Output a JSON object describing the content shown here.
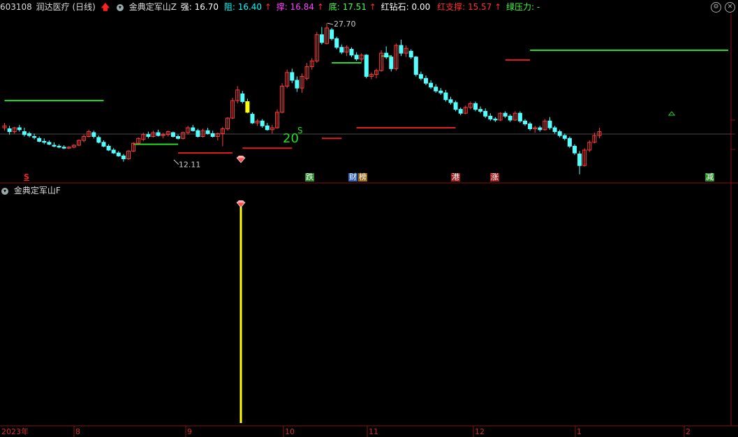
{
  "header": {
    "code": "603108",
    "name": "润达医疗",
    "period": "(日线)",
    "indicator": "金典定军山Z",
    "strong_label": "强:",
    "strong_value": "16.70",
    "resist_label": "阻:",
    "resist_value": "16.40",
    "support_label": "撑:",
    "support_value": "16.84",
    "bottom_label": "底:",
    "bottom_value": "17.51",
    "diamond_label": "红钻石:",
    "diamond_value": "0.00",
    "red_support_label": "红支撑:",
    "red_support_value": "15.57",
    "green_pressure_label": "绿压力:",
    "green_pressure_value": "-",
    "colors": {
      "strong": "#ffffff",
      "resist": "#00ffff",
      "support": "#ff40ff",
      "bottom": "#40ff40",
      "diamond": "#ffffff",
      "red_support": "#ff3030",
      "green_pressure": "#40ff40"
    }
  },
  "sub_panel": {
    "title": "金典定军山F"
  },
  "annotations": {
    "high": "27.70",
    "low": "12.11",
    "green_num": "20",
    "green_s": "S"
  },
  "event_tags": [
    {
      "text": "S",
      "color": "#ff2020",
      "bg": "none"
    },
    {
      "text": "跌",
      "color": "#ffffff",
      "bg": "#2a8a2a"
    },
    {
      "text": "财",
      "color": "#ffffff",
      "bg": "#2b5fb0"
    },
    {
      "text": "榜",
      "color": "#ffffff",
      "bg": "#9a6a20"
    },
    {
      "text": "港",
      "color": "#ffffff",
      "bg": "#a02020"
    },
    {
      "text": "涨",
      "color": "#ffffff",
      "bg": "#a02020"
    },
    {
      "text": "减",
      "color": "#ffffff",
      "bg": "#2a8a2a"
    }
  ],
  "time_axis": [
    "2023年",
    "8",
    "9",
    "10",
    "11",
    "12",
    "1",
    "2"
  ],
  "colors": {
    "up": "#ff3c3c",
    "down": "#54ffff",
    "green_line": "#22dd22",
    "red_line": "#e02020",
    "grid": "#8a1010",
    "signal_bar": "#ffff00"
  },
  "chart_data": {
    "type": "candlestick",
    "ylim": [
      11.5,
      28.5
    ],
    "candles": [
      [
        16.9,
        17.4,
        16.6,
        17.1
      ],
      [
        16.8,
        17.1,
        16.2,
        16.5
      ],
      [
        16.5,
        17.0,
        16.3,
        16.9
      ],
      [
        16.9,
        17.2,
        16.5,
        16.7
      ],
      [
        16.5,
        16.9,
        16.0,
        16.2
      ],
      [
        16.3,
        16.5,
        15.9,
        16.1
      ],
      [
        16.0,
        16.3,
        15.7,
        15.9
      ],
      [
        15.8,
        16.0,
        15.4,
        15.5
      ],
      [
        15.5,
        15.8,
        15.2,
        15.4
      ],
      [
        15.4,
        15.6,
        15.1,
        15.2
      ],
      [
        15.1,
        15.4,
        14.9,
        15.0
      ],
      [
        15.0,
        15.2,
        14.8,
        14.9
      ],
      [
        14.9,
        15.1,
        14.7,
        14.8
      ],
      [
        14.8,
        15.0,
        14.7,
        14.9
      ],
      [
        14.9,
        15.2,
        14.8,
        15.1
      ],
      [
        15.1,
        15.7,
        15.0,
        15.6
      ],
      [
        15.6,
        16.2,
        15.4,
        16.0
      ],
      [
        16.0,
        16.7,
        15.9,
        16.5
      ],
      [
        16.4,
        16.6,
        15.8,
        16.0
      ],
      [
        15.9,
        16.1,
        15.3,
        15.4
      ],
      [
        15.4,
        15.6,
        14.9,
        15.0
      ],
      [
        15.0,
        15.2,
        14.5,
        14.6
      ],
      [
        14.6,
        14.8,
        14.2,
        14.3
      ],
      [
        14.3,
        14.5,
        13.9,
        14.0
      ],
      [
        14.0,
        14.2,
        13.4,
        13.7
      ],
      [
        13.7,
        14.6,
        13.6,
        14.5
      ],
      [
        14.5,
        15.4,
        14.4,
        15.3
      ],
      [
        15.3,
        15.9,
        15.1,
        15.8
      ],
      [
        15.7,
        16.4,
        15.5,
        16.2
      ],
      [
        16.2,
        16.5,
        15.8,
        16.0
      ],
      [
        16.0,
        16.6,
        15.9,
        16.4
      ],
      [
        16.4,
        16.7,
        16.0,
        16.1
      ],
      [
        16.1,
        16.4,
        15.8,
        16.2
      ],
      [
        16.2,
        16.6,
        16.0,
        16.5
      ],
      [
        16.4,
        16.5,
        15.9,
        16.0
      ],
      [
        16.0,
        16.2,
        15.7,
        15.8
      ],
      [
        15.8,
        16.5,
        15.7,
        16.4
      ],
      [
        16.4,
        17.1,
        16.2,
        16.9
      ],
      [
        16.9,
        17.2,
        16.5,
        16.6
      ],
      [
        16.6,
        16.8,
        15.9,
        16.0
      ],
      [
        16.0,
        16.8,
        15.9,
        16.6
      ],
      [
        16.6,
        16.9,
        16.2,
        16.3
      ],
      [
        16.3,
        16.6,
        15.9,
        16.0
      ],
      [
        16.0,
        16.4,
        15.6,
        16.3
      ],
      [
        16.3,
        17.0,
        15.0,
        16.8
      ],
      [
        16.8,
        18.0,
        16.6,
        17.9
      ],
      [
        17.9,
        20.0,
        17.8,
        19.7
      ],
      [
        19.7,
        21.2,
        19.4,
        20.8
      ],
      [
        20.4,
        20.7,
        19.4,
        19.6
      ],
      [
        19.6,
        19.9,
        18.4,
        18.5
      ],
      [
        18.3,
        18.5,
        17.3,
        17.4
      ],
      [
        17.4,
        17.8,
        17.1,
        17.6
      ],
      [
        17.6,
        17.8,
        16.9,
        17.1
      ],
      [
        17.1,
        17.4,
        16.6,
        16.7
      ],
      [
        16.7,
        17.2,
        16.3,
        16.9
      ],
      [
        16.9,
        18.8,
        16.8,
        18.5
      ],
      [
        18.5,
        21.5,
        18.4,
        21.2
      ],
      [
        21.2,
        22.9,
        21.0,
        22.6
      ],
      [
        22.6,
        23.0,
        21.5,
        21.8
      ],
      [
        21.8,
        22.2,
        20.6,
        21.0
      ],
      [
        21.0,
        22.5,
        20.5,
        22.2
      ],
      [
        22.0,
        23.6,
        21.8,
        23.2
      ],
      [
        23.2,
        24.1,
        22.9,
        23.8
      ],
      [
        23.8,
        26.8,
        23.6,
        26.5
      ],
      [
        26.5,
        27.3,
        25.5,
        25.7
      ],
      [
        25.6,
        27.7,
        25.5,
        27.2
      ],
      [
        27.0,
        27.2,
        25.9,
        26.1
      ],
      [
        26.1,
        26.3,
        25.0,
        25.2
      ],
      [
        25.2,
        25.5,
        24.5,
        24.7
      ],
      [
        24.7,
        25.4,
        24.3,
        25.2
      ],
      [
        25.0,
        25.2,
        24.2,
        24.4
      ],
      [
        24.4,
        24.7,
        23.8,
        24.0
      ],
      [
        24.0,
        24.6,
        23.7,
        24.4
      ],
      [
        24.4,
        24.5,
        22.0,
        22.2
      ],
      [
        22.2,
        22.6,
        21.9,
        22.4
      ],
      [
        22.4,
        23.0,
        22.0,
        22.8
      ],
      [
        22.8,
        24.9,
        22.7,
        24.6
      ],
      [
        24.6,
        25.3,
        24.0,
        24.2
      ],
      [
        24.2,
        24.4,
        22.7,
        23.0
      ],
      [
        23.0,
        25.6,
        22.8,
        25.4
      ],
      [
        25.4,
        26.0,
        24.3,
        24.6
      ],
      [
        24.6,
        25.4,
        24.2,
        25.1
      ],
      [
        24.8,
        25.0,
        24.0,
        24.2
      ],
      [
        24.2,
        24.3,
        22.2,
        22.4
      ],
      [
        22.4,
        22.7,
        21.8,
        22.0
      ],
      [
        22.0,
        22.3,
        21.3,
        21.5
      ],
      [
        21.5,
        21.8,
        20.9,
        21.1
      ],
      [
        21.1,
        21.4,
        20.5,
        20.7
      ],
      [
        20.7,
        21.0,
        20.3,
        20.5
      ],
      [
        20.5,
        20.8,
        19.6,
        19.8
      ],
      [
        19.8,
        20.1,
        19.3,
        19.5
      ],
      [
        19.5,
        19.7,
        18.6,
        18.8
      ],
      [
        18.8,
        19.0,
        18.2,
        18.4
      ],
      [
        18.4,
        19.2,
        18.3,
        19.0
      ],
      [
        19.0,
        19.6,
        18.8,
        19.4
      ],
      [
        19.4,
        19.6,
        18.6,
        18.8
      ],
      [
        18.8,
        19.1,
        18.4,
        18.6
      ],
      [
        18.6,
        18.9,
        17.9,
        18.1
      ],
      [
        18.1,
        18.4,
        17.6,
        17.8
      ],
      [
        17.8,
        18.0,
        17.5,
        17.7
      ],
      [
        17.7,
        18.5,
        17.6,
        18.4
      ],
      [
        18.4,
        18.6,
        17.9,
        18.1
      ],
      [
        18.1,
        18.3,
        17.5,
        17.7
      ],
      [
        17.7,
        18.6,
        17.6,
        18.4
      ],
      [
        18.4,
        18.6,
        17.4,
        17.6
      ],
      [
        17.6,
        17.8,
        17.1,
        17.3
      ],
      [
        17.3,
        17.5,
        16.6,
        16.8
      ],
      [
        16.8,
        17.1,
        16.4,
        16.9
      ],
      [
        16.9,
        17.1,
        16.5,
        16.7
      ],
      [
        16.7,
        17.8,
        16.6,
        17.6
      ],
      [
        17.6,
        18.0,
        16.7,
        16.9
      ],
      [
        16.9,
        17.1,
        16.3,
        16.5
      ],
      [
        16.5,
        16.7,
        15.9,
        16.1
      ],
      [
        16.1,
        16.3,
        15.6,
        15.8
      ],
      [
        15.8,
        16.0,
        14.8,
        15.0
      ],
      [
        15.0,
        15.2,
        14.1,
        14.3
      ],
      [
        14.2,
        14.5,
        12.1,
        13.0
      ],
      [
        13.0,
        14.8,
        12.9,
        14.6
      ],
      [
        14.6,
        15.6,
        14.4,
        15.4
      ],
      [
        15.4,
        16.4,
        15.3,
        16.1
      ],
      [
        16.1,
        16.9,
        15.8,
        16.5
      ]
    ],
    "green_levels": [
      [
        0,
        20,
        19.7
      ],
      [
        26,
        35,
        15.2
      ],
      [
        66,
        72,
        23.6
      ],
      [
        76,
        78,
        24.3
      ],
      [
        106,
        146,
        24.9
      ]
    ],
    "red_levels": [
      [
        35,
        46,
        14.3
      ],
      [
        48,
        58,
        14.8
      ],
      [
        64,
        68,
        15.8
      ],
      [
        71,
        91,
        16.9
      ],
      [
        101,
        106,
        23.9
      ]
    ],
    "signal_bar_index": 49
  }
}
